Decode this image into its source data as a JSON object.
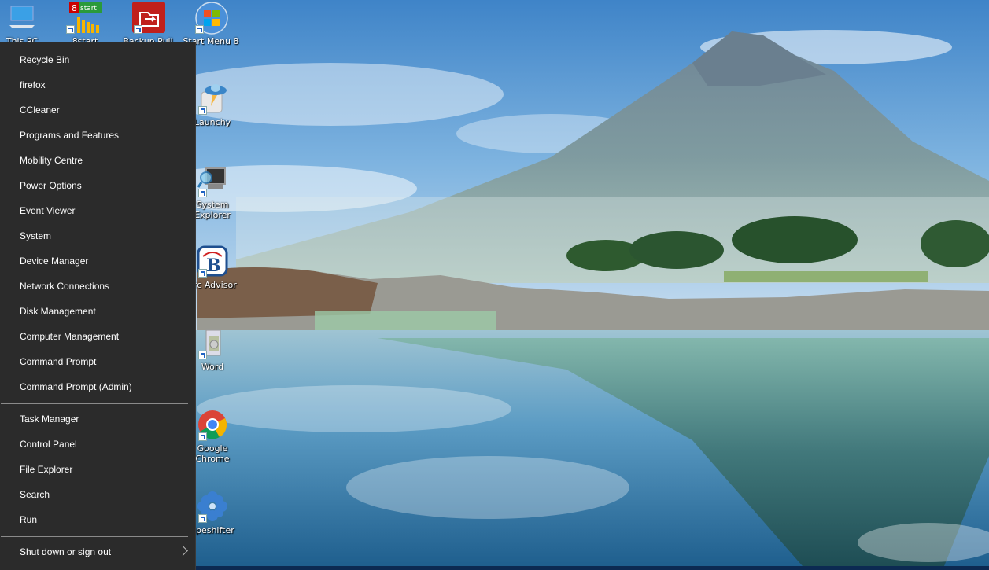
{
  "desktop": {
    "icons": [
      {
        "label": "This PC",
        "icon": "computer-icon"
      },
      {
        "label": "8start",
        "icon": "8start-icon"
      },
      {
        "label": "Backup Pull",
        "icon": "folder-sync-icon"
      },
      {
        "label": "Start Menu 8",
        "icon": "windows-orb-icon"
      },
      {
        "label": "Launchy",
        "icon": "launchy-ufo-icon"
      },
      {
        "label": "System\nExplorer",
        "icon": "system-explorer-icon"
      },
      {
        "label": "arc Advisor",
        "icon": "belarc-b-icon"
      },
      {
        "label": "Word",
        "icon": "word-installer-icon"
      },
      {
        "label": "Google\nChrome",
        "icon": "chrome-icon"
      },
      {
        "label": "apeshifter",
        "icon": "flower-icon"
      }
    ]
  },
  "winx_menu": {
    "group1": [
      "Recycle Bin",
      "firefox",
      "CCleaner",
      "Programs and Features",
      "Mobility Centre",
      "Power Options",
      "Event Viewer",
      "System",
      "Device Manager",
      "Network Connections",
      "Disk Management",
      "Computer Management",
      "Command Prompt",
      "Command Prompt (Admin)"
    ],
    "group2": [
      "Task Manager",
      "Control Panel",
      "File Explorer",
      "Search",
      "Run"
    ],
    "shutdown": {
      "label": "Shut down or sign out",
      "has_submenu": true
    }
  },
  "colors": {
    "menu_bg": "#2b2b2b",
    "menu_text": "#ffffff",
    "separator": "#8a8a8a",
    "taskbar": "#0c2a52"
  }
}
